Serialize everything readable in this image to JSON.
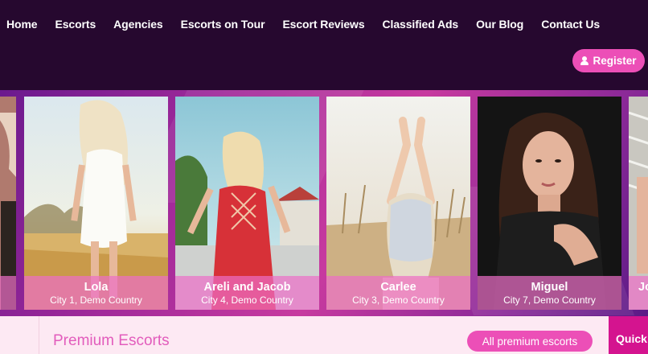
{
  "nav": {
    "items": [
      "Home",
      "Escorts",
      "Agencies",
      "Escorts on Tour",
      "Escort Reviews",
      "Classified Ads",
      "Our Blog",
      "Contact Us"
    ],
    "register_label": "Register"
  },
  "carousel": {
    "cards": [
      {
        "name": "",
        "city": ""
      },
      {
        "name": "Lola",
        "city": "City 1, Demo Country"
      },
      {
        "name": "Areli and Jacob",
        "city": "City 4, Demo Country"
      },
      {
        "name": "Carlee",
        "city": "City 3, Demo Country"
      },
      {
        "name": "Miguel",
        "city": "City 7, Demo Country"
      },
      {
        "name": "Jo",
        "city": ""
      }
    ]
  },
  "premium": {
    "title": "Premium Escorts",
    "all_button": "All premium escorts",
    "quick_label": "Quick"
  },
  "colors": {
    "header_bg": "#26082f",
    "accent_pink": "#ec4fb7",
    "quick_bg": "#d4148f",
    "premium_text": "#e25cbc"
  }
}
